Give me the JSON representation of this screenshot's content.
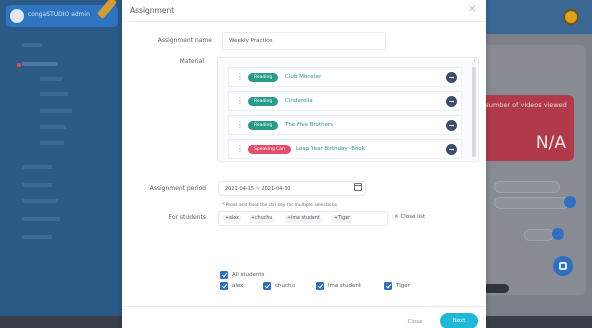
{
  "modal": {
    "title": "Assignment",
    "close_icon": "close-icon",
    "labels": {
      "name": "Assignment name",
      "material": "Material",
      "period": "Assignment period",
      "for_students": "For students"
    },
    "name_value": "Weekly Practice",
    "materials": [
      {
        "type": "Reading",
        "title": "Club Monster"
      },
      {
        "type": "Reading",
        "title": "Cinderella"
      },
      {
        "type": "Reading",
        "title": "The Five Brothers"
      },
      {
        "type": "Speaking Can",
        "title": "Leap Year Birthday -Book"
      }
    ],
    "period_value": "2021-04-15 ~ 2021-04-30",
    "hint": "Press and hold the ctrl key for multiple selections.",
    "selected_tags": [
      "alex",
      "chuchu",
      "lma student",
      "Tiger"
    ],
    "close_list_label": "Close list",
    "all_students_label": "All students",
    "students": [
      "alex",
      "chuchu",
      "lma student",
      "Tiger"
    ],
    "footer": {
      "close_label": "Close",
      "next_label": "Next"
    }
  },
  "background": {
    "brand_text": "congaSTUDIO admin",
    "stat_label": "Number of videos viewed",
    "stat_value": "N/A",
    "colors": {
      "accent": "#20b8d8",
      "badge_reading": "#2a9a8c",
      "badge_speaking": "#e0506c",
      "checkbox": "#2f6fbf"
    }
  }
}
